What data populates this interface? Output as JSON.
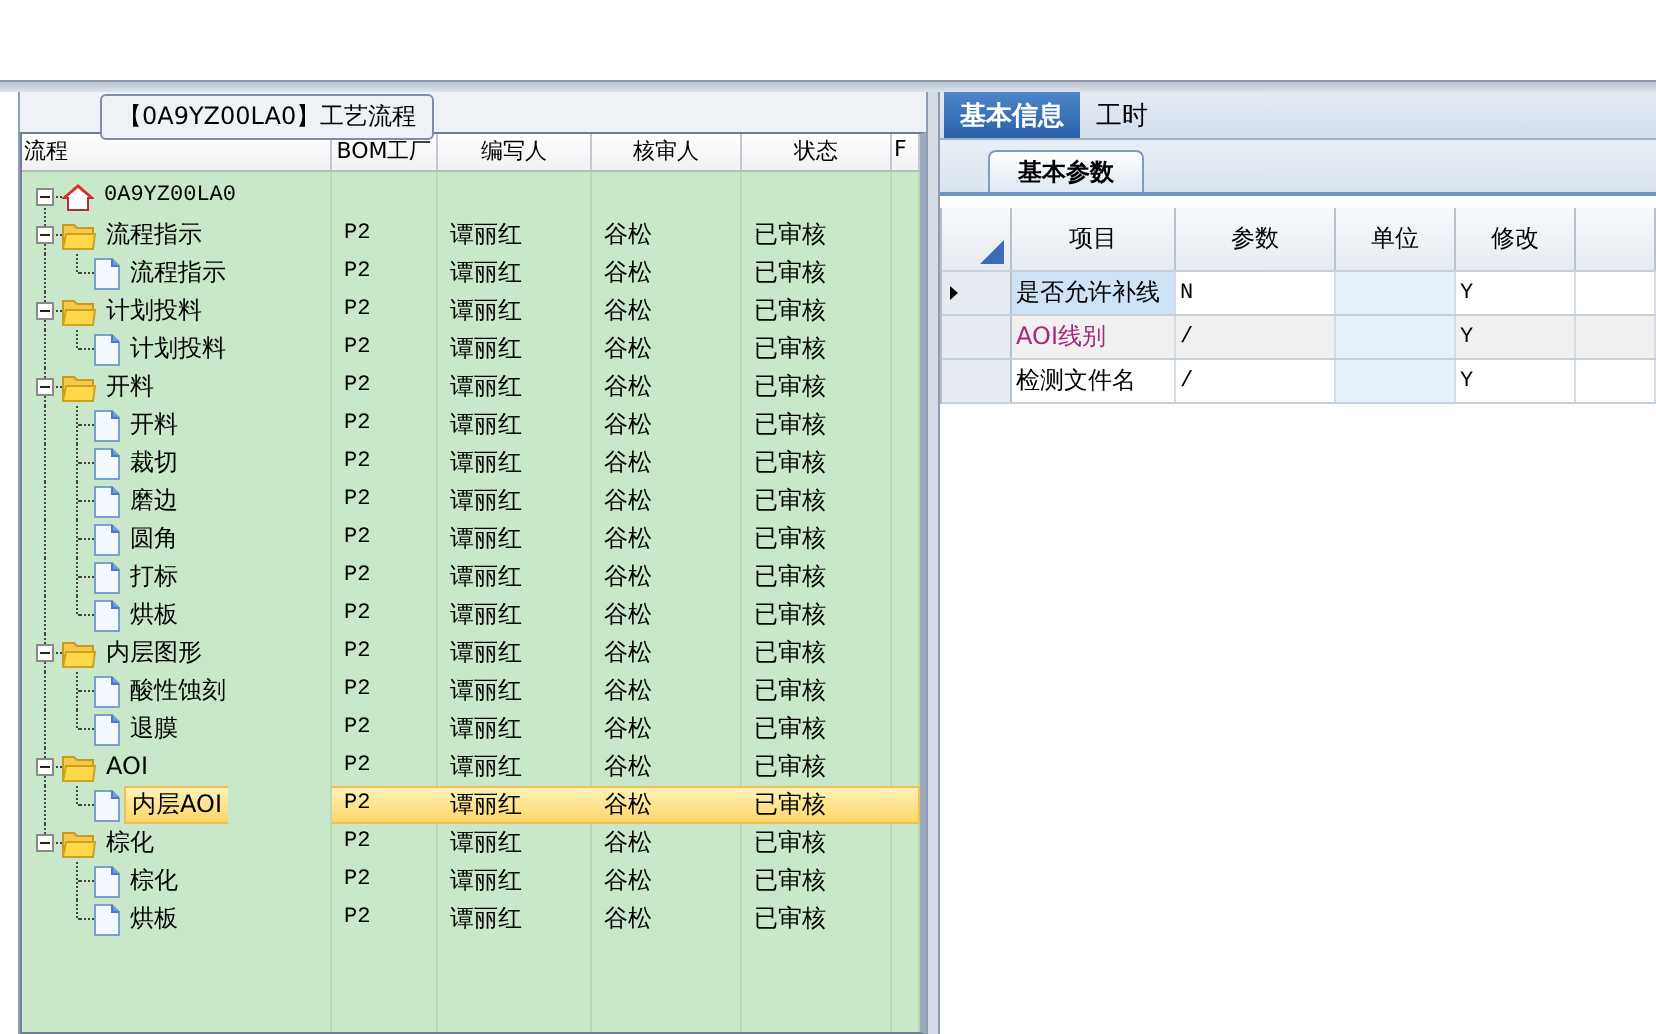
{
  "group_title": "【0A9YZ00LA0】工艺流程",
  "tree": {
    "columns": [
      "流程",
      "BOM工厂",
      "编写人",
      "核审人",
      "状态",
      "F"
    ],
    "nodes": [
      {
        "kind": "root",
        "name": "0A9YZ00LA0",
        "expanded": true,
        "selected": false,
        "children": [
          {
            "kind": "folder",
            "name": "流程指示",
            "bom": "P2",
            "writer": "谭丽红",
            "reviewer": "谷松",
            "status": "已审核",
            "expanded": true,
            "selected": false,
            "children": [
              {
                "kind": "file",
                "name": "流程指示",
                "bom": "P2",
                "writer": "谭丽红",
                "reviewer": "谷松",
                "status": "已审核",
                "selected": false
              }
            ]
          },
          {
            "kind": "folder",
            "name": "计划投料",
            "bom": "P2",
            "writer": "谭丽红",
            "reviewer": "谷松",
            "status": "已审核",
            "expanded": true,
            "selected": false,
            "children": [
              {
                "kind": "file",
                "name": "计划投料",
                "bom": "P2",
                "writer": "谭丽红",
                "reviewer": "谷松",
                "status": "已审核",
                "selected": false
              }
            ]
          },
          {
            "kind": "folder",
            "name": "开料",
            "bom": "P2",
            "writer": "谭丽红",
            "reviewer": "谷松",
            "status": "已审核",
            "expanded": true,
            "selected": false,
            "children": [
              {
                "kind": "file",
                "name": "开料",
                "bom": "P2",
                "writer": "谭丽红",
                "reviewer": "谷松",
                "status": "已审核",
                "selected": false
              },
              {
                "kind": "file",
                "name": "裁切",
                "bom": "P2",
                "writer": "谭丽红",
                "reviewer": "谷松",
                "status": "已审核",
                "selected": false
              },
              {
                "kind": "file",
                "name": "磨边",
                "bom": "P2",
                "writer": "谭丽红",
                "reviewer": "谷松",
                "status": "已审核",
                "selected": false
              },
              {
                "kind": "file",
                "name": "圆角",
                "bom": "P2",
                "writer": "谭丽红",
                "reviewer": "谷松",
                "status": "已审核",
                "selected": false
              },
              {
                "kind": "file",
                "name": "打标",
                "bom": "P2",
                "writer": "谭丽红",
                "reviewer": "谷松",
                "status": "已审核",
                "selected": false
              },
              {
                "kind": "file",
                "name": "烘板",
                "bom": "P2",
                "writer": "谭丽红",
                "reviewer": "谷松",
                "status": "已审核",
                "selected": false
              }
            ]
          },
          {
            "kind": "folder",
            "name": "内层图形",
            "bom": "P2",
            "writer": "谭丽红",
            "reviewer": "谷松",
            "status": "已审核",
            "expanded": true,
            "selected": false,
            "children": [
              {
                "kind": "file",
                "name": "酸性蚀刻",
                "bom": "P2",
                "writer": "谭丽红",
                "reviewer": "谷松",
                "status": "已审核",
                "selected": false
              },
              {
                "kind": "file",
                "name": "退膜",
                "bom": "P2",
                "writer": "谭丽红",
                "reviewer": "谷松",
                "status": "已审核",
                "selected": false
              }
            ]
          },
          {
            "kind": "folder",
            "name": "AOI",
            "bom": "P2",
            "writer": "谭丽红",
            "reviewer": "谷松",
            "status": "已审核",
            "expanded": true,
            "selected": false,
            "children": [
              {
                "kind": "file",
                "name": "内层AOI",
                "bom": "P2",
                "writer": "谭丽红",
                "reviewer": "谷松",
                "status": "已审核",
                "selected": true
              }
            ]
          },
          {
            "kind": "folder",
            "name": "棕化",
            "bom": "P2",
            "writer": "谭丽红",
            "reviewer": "谷松",
            "status": "已审核",
            "expanded": true,
            "selected": false,
            "children": [
              {
                "kind": "file",
                "name": "棕化",
                "bom": "P2",
                "writer": "谭丽红",
                "reviewer": "谷松",
                "status": "已审核",
                "selected": false
              },
              {
                "kind": "file",
                "name": "烘板",
                "bom": "P2",
                "writer": "谭丽红",
                "reviewer": "谷松",
                "status": "已审核",
                "selected": false
              }
            ]
          }
        ]
      }
    ]
  },
  "tabs": [
    {
      "label": "基本信息",
      "selected": true
    },
    {
      "label": "工时",
      "selected": false
    }
  ],
  "sub_tabs": [
    {
      "label": "基本参数",
      "selected": true
    }
  ],
  "params": {
    "columns": [
      "项目",
      "参数",
      "单位",
      "修改"
    ],
    "rows": [
      {
        "item": "是否允许补线",
        "value": "N",
        "modify": "Y",
        "selected": true,
        "color": "#000000"
      },
      {
        "item": "AOI线别",
        "value": "/",
        "modify": "Y",
        "selected": false,
        "color": "#a8287c"
      },
      {
        "item": "检测文件名",
        "value": "/",
        "modify": "Y",
        "selected": false,
        "color": "#000000"
      }
    ]
  }
}
